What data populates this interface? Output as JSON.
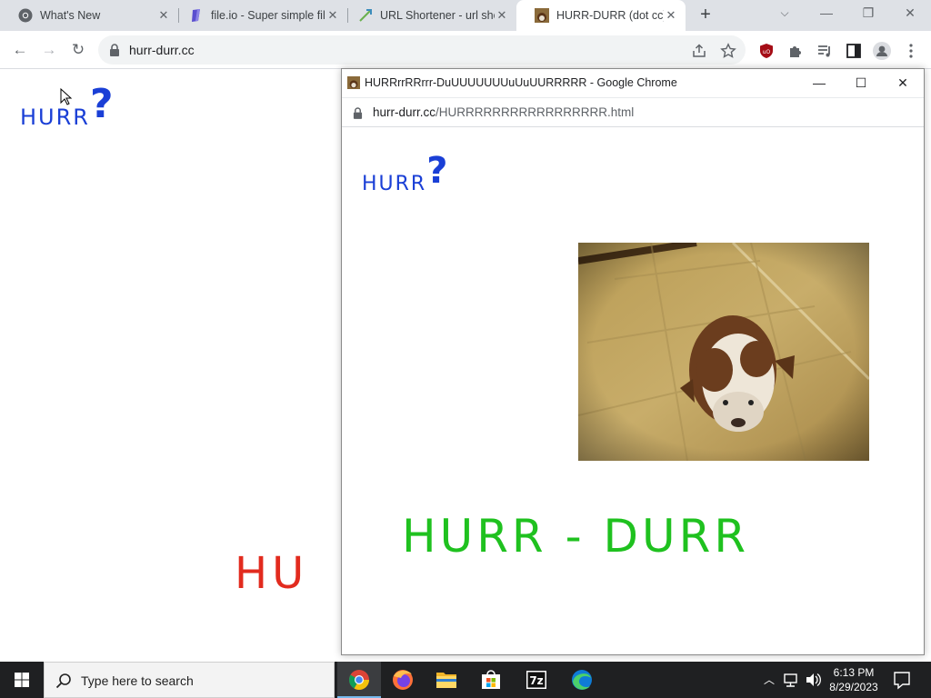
{
  "browser": {
    "tabs": [
      {
        "title": "What's New",
        "active": false
      },
      {
        "title": "file.io - Super simple fil",
        "active": false
      },
      {
        "title": "URL Shortener - url sho",
        "active": false
      },
      {
        "title": "HURR-DURR (dot cc)",
        "active": true
      }
    ],
    "address": "hurr-durr.cc"
  },
  "page": {
    "logo_word": "HURR",
    "logo_mark": "?",
    "red_text": "HU"
  },
  "popup": {
    "title": "HURRrrRRrrr-DuUUUUUUUuUuUURRRRR - Google Chrome",
    "url_host": "hurr-durr.cc",
    "url_path": "/HURRRRRRRRRRRRRRRRR.html",
    "logo_word": "HURR",
    "logo_mark": "?",
    "green_text": "HURR - DURR"
  },
  "taskbar": {
    "search_placeholder": "Type here to search",
    "time": "6:13 PM",
    "date": "8/29/2023"
  },
  "colors": {
    "logo_blue": "#1a3fd6",
    "red_text": "#e22b1e",
    "green_text": "#1fc11f"
  }
}
